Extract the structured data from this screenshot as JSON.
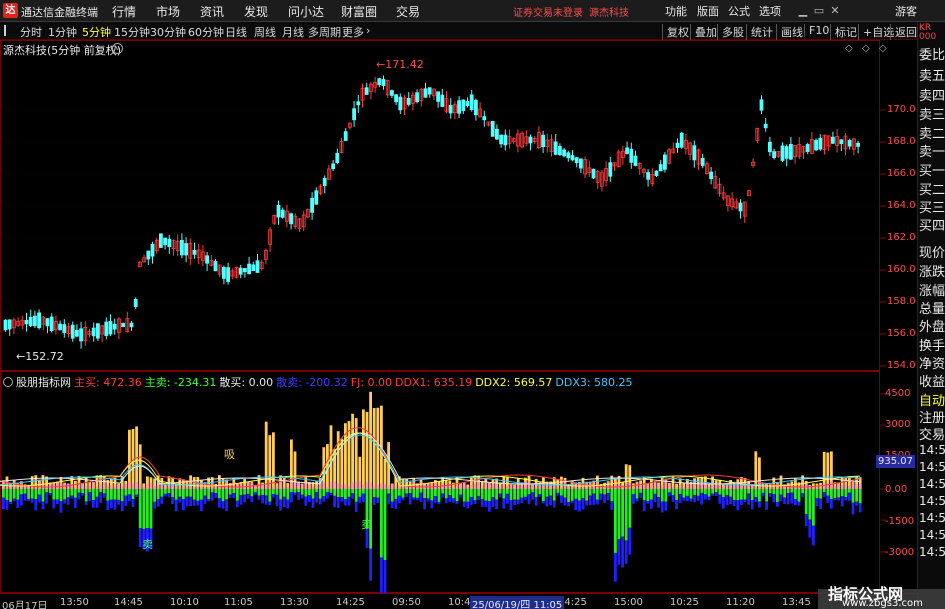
{
  "window": {
    "title": "通达信金融终端",
    "logo_glyph": "达",
    "menus": [
      "行情",
      "市场",
      "资讯",
      "发现",
      "问小达",
      "财富圈",
      "交易"
    ],
    "notices": [
      "证券交易未登录",
      "源杰科技"
    ],
    "right_menus": [
      "功能",
      "版面",
      "公式",
      "选项",
      "游客"
    ],
    "controls": [
      "▁",
      "▭",
      "✕"
    ]
  },
  "periods": {
    "items": [
      "分时",
      "1分钟",
      "5分钟",
      "15分钟",
      "30分钟",
      "60分钟",
      "日线",
      "周线",
      "月线",
      "多周期",
      "更多"
    ],
    "active": "5分钟",
    "more_glyph": "›"
  },
  "tools": [
    "复权",
    "叠加",
    "多股",
    "统计",
    "画线",
    "F10",
    "标记",
    "+自选",
    "返回"
  ],
  "kline": {
    "header": "源杰科技(5分钟 前复权)",
    "high_label": "171.42",
    "low_label": "152.72",
    "y_ticks": [
      "170.0",
      "168.0",
      "166.0",
      "164.0",
      "162.0",
      "160.0",
      "158.0",
      "156.0",
      "154.0"
    ],
    "corner_icons": [
      "◇",
      "◇",
      "◇"
    ]
  },
  "indicator": {
    "name": "股朋指标网",
    "fields": [
      {
        "label": "主买: 472.36",
        "color": "#ff3a3a"
      },
      {
        "label": "主卖: -234.31",
        "color": "#3aff3a"
      },
      {
        "label": "散买: 0.00",
        "color": "#e8e8e8"
      },
      {
        "label": "散卖: -200.32",
        "color": "#3a3aff"
      },
      {
        "label": "FJ: 0.00",
        "color": "#ff3a3a"
      },
      {
        "label": "DDX1: 635.19",
        "color": "#ff3a3a"
      },
      {
        "label": "DDX2: 569.57",
        "color": "#ffff3a"
      },
      {
        "label": "DDX3: 580.25",
        "color": "#3ac8ff"
      }
    ],
    "y_ticks": [
      "4500",
      "3000",
      "1500",
      "0.00",
      "-1500",
      "-3000"
    ],
    "current_value": "935.07",
    "signal_buy": "吸",
    "signal_sell": "卖"
  },
  "side_panel": {
    "logo": "KR\n000",
    "items": [
      "委比",
      "卖五",
      "卖四",
      "卖三",
      "卖二",
      "卖一",
      "买一",
      "买二",
      "买三",
      "买四",
      "买五",
      "现价",
      "涨跌",
      "涨幅",
      "总量",
      "外盘",
      "换手",
      "净资",
      "收益",
      "自动",
      "注册",
      "交易"
    ],
    "times": [
      "14:5",
      "14:5",
      "14:5",
      "14:5",
      "14:5",
      "14:5",
      "14:5"
    ]
  },
  "time_axis": {
    "labels": [
      "06月17日",
      "13:50",
      "14:45",
      "10:10",
      "11:05",
      "13:30",
      "14:25",
      "09:50",
      "10:4",
      "14:25",
      "15:00",
      "10:25",
      "11:20",
      "13:45"
    ],
    "cursor": "25/06/19/四 11:05"
  },
  "watermark": {
    "title": "指标公式网",
    "url": "www.zbgs3.com"
  },
  "colors": {
    "up": "#ff3a3a",
    "down": "#54ffff",
    "grid": "#7a0000",
    "buy_bar": "#ffcc55",
    "sell_bar": "#22ee22",
    "retail_sell": "#2020ff",
    "accent_yellow": "#ffff3a"
  }
}
